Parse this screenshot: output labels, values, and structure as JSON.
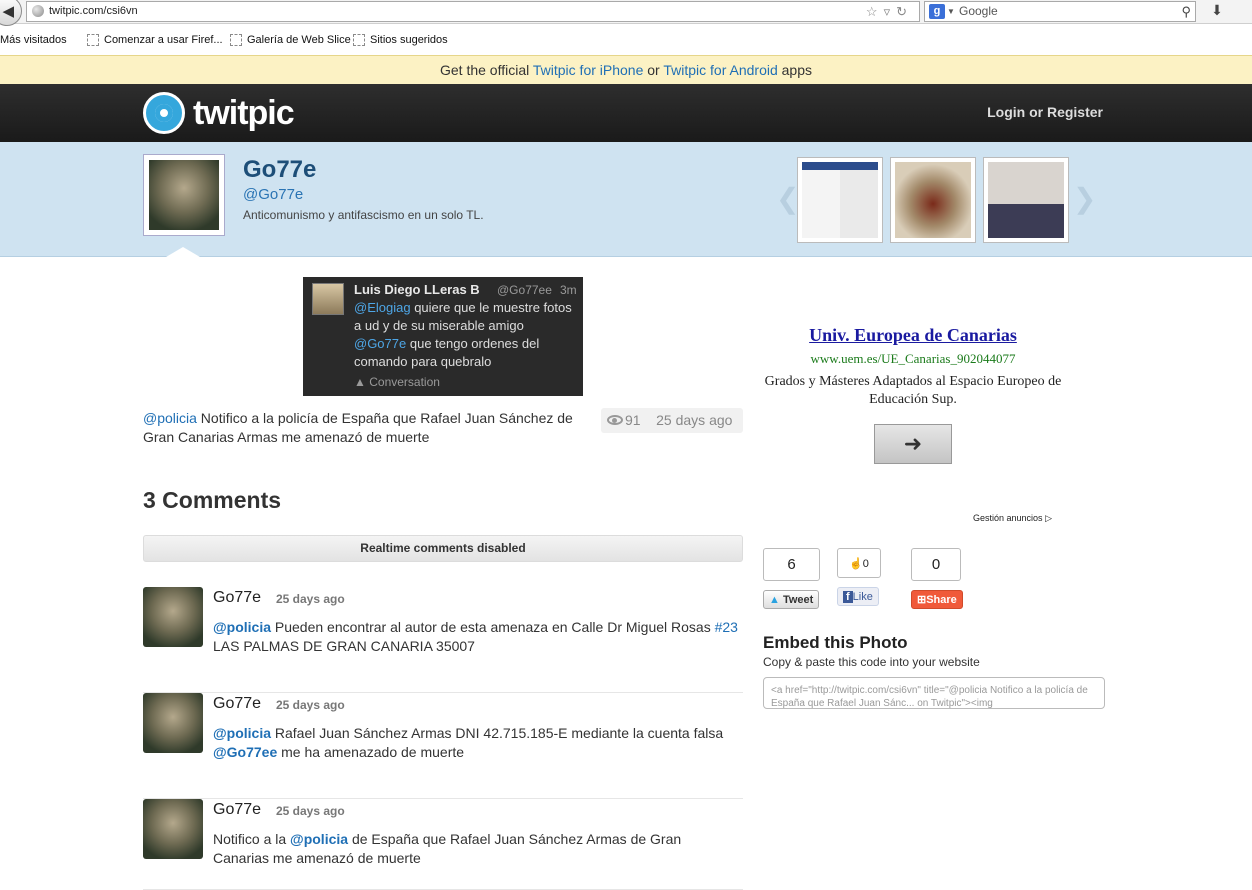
{
  "browser": {
    "url": "twitpic.com/csi6vn",
    "search_placeholder": "Google",
    "bookmarks": [
      "Más visitados",
      "Comenzar a usar Firef...",
      "Galería de Web Slice",
      "Sitios sugeridos"
    ]
  },
  "promo": {
    "prefix": "Get the official",
    "iphone": "Twitpic for iPhone",
    "or": "or",
    "android": "Twitpic for Android",
    "suffix": "apps"
  },
  "header": {
    "logo": "twitpic",
    "login": "Login or Register"
  },
  "profile": {
    "name": "Go77e",
    "handle": "@Go77e",
    "bio": "Anticomunismo y antifascismo en un solo TL."
  },
  "tweet": {
    "name": "Luis Diego LLeras B",
    "handle": "@Go77ee",
    "time": "3m",
    "mention1": "@Elogiag",
    "text1": "quiere que le muestre fotos a ud y de su miserable amigo",
    "mention2": "@Go77e",
    "text2": "que tengo ordenes del comando para quebralo",
    "conversation": "Conversation"
  },
  "caption": {
    "mention": "@policia",
    "text": "Notifico a la policía de España que Rafael Juan Sánchez de Gran Canarias Armas me amenazó de muerte",
    "views": "91",
    "age": "25 days ago"
  },
  "comments": {
    "title": "3 Comments",
    "realtime": "Realtime comments disabled",
    "items": [
      {
        "user": "Go77e",
        "time": "25 days ago",
        "mention": "@policia",
        "text": "Pueden encontrar al autor de esta amenaza en Calle Dr Miguel Rosas",
        "tag": "#23",
        "text2": "LAS PALMAS DE GRAN CANARIA 35007"
      },
      {
        "user": "Go77e",
        "time": "25 days ago",
        "mention": "@policia",
        "text": "Rafael Juan Sánchez Armas DNI 42.715.185-E mediante la cuenta falsa",
        "tag": "@Go77ee",
        "text2": "me ha amenazado de muerte"
      },
      {
        "user": "Go77e",
        "time": "25 days ago",
        "pre": "Notifico a la",
        "mention": "@policia",
        "text": "de España que Rafael Juan Sánchez Armas de Gran Canarias me amenazó de muerte"
      }
    ]
  },
  "ad": {
    "title": "Univ. Europea de Canarias",
    "url": "www.uem.es/UE_Canarias_902044077",
    "desc": "Grados y Másteres Adaptados al Espacio Europeo de Educación Sup.",
    "choices": "Gestión anuncios"
  },
  "share": {
    "tweet_count": "6",
    "tweet_label": "Tweet",
    "like_count": "0",
    "like_label": "Like",
    "share_count": "0",
    "share_label": "Share"
  },
  "embed": {
    "title": "Embed this Photo",
    "subtitle": "Copy & paste this code into your website",
    "code": "<a href=\"http://twitpic.com/csi6vn\" title=\"@policia Notifico a la policía de España que Rafael Juan Sánc... on Twitpic\"><img"
  },
  "colors": {
    "link": "#1f6fb5",
    "promo_bg": "#fcf2c4",
    "band_bg": "#cfe3f1",
    "header_bg": "#1f1f1f"
  }
}
